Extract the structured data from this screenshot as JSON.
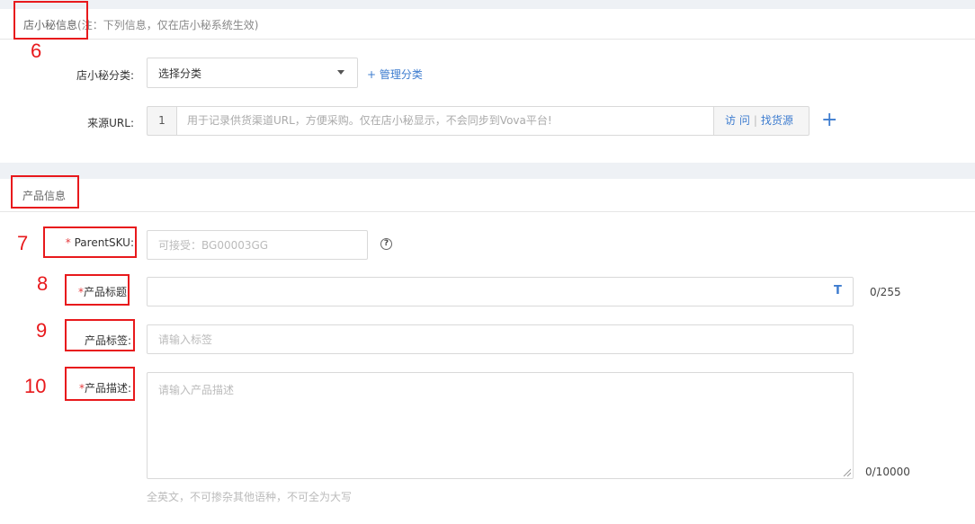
{
  "store_section": {
    "title": "店小秘信息",
    "note": "(注：下列信息，仅在店小秘系统生效)",
    "marker": "6",
    "category_label": "店小秘分类:",
    "category_value": "选择分类",
    "manage_category_link": "+ 管理分类",
    "url_label": "来源URL:",
    "url_index": "1",
    "url_placeholder": "用于记录供货渠道URL，方便采购。仅在店小秘显示，不会同步到Vova平台!",
    "visit_label": "访 问",
    "addon_sep": "|",
    "find_source_label": "找货源",
    "add_url_symbol": "+"
  },
  "product_section": {
    "title": "产品信息",
    "parent_sku": {
      "marker": "7",
      "required_mark": "*",
      "label": "ParentSKU:",
      "placeholder": "可接受：BG00003GG",
      "help_symbol": "?"
    },
    "title_field": {
      "marker": "8",
      "required_mark": "*",
      "label": "产品标题",
      "value": "",
      "icon_symbol": "T",
      "counter": "0/255"
    },
    "tags_field": {
      "marker": "9",
      "label": "产品标签:",
      "placeholder": "请输入标签"
    },
    "description_field": {
      "marker": "10",
      "required_mark": "*",
      "label": "产品描述:",
      "placeholder": "请输入产品描述",
      "counter": "0/10000",
      "hint": "全英文，不可掺杂其他语种，不可全为大写"
    }
  },
  "colors": {
    "accent": "#3d7ccf",
    "annotation_red": "#e8191c",
    "required_red": "#e4393c"
  }
}
